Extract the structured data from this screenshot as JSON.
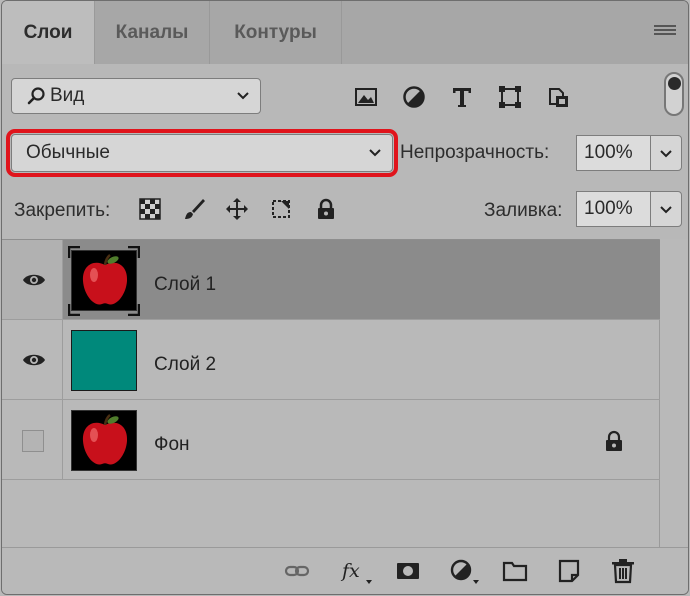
{
  "tabs": [
    {
      "label": "Слои",
      "active": true
    },
    {
      "label": "Каналы",
      "active": false
    },
    {
      "label": "Контуры",
      "active": false
    }
  ],
  "filter": {
    "label": "Вид"
  },
  "blend_mode": {
    "value": "Обычные",
    "highlight_color": "#e0141c"
  },
  "opacity": {
    "label": "Непрозрачность:",
    "value": "100%"
  },
  "lock": {
    "label": "Закрепить:"
  },
  "fill": {
    "label": "Заливка:",
    "value": "100%"
  },
  "layers": [
    {
      "name": "Слой 1",
      "visible": true,
      "selected": true,
      "thumb": "apple"
    },
    {
      "name": "Слой 2",
      "visible": true,
      "selected": false,
      "thumb": "teal",
      "thumb_color": "#00897b"
    },
    {
      "name": "Фон",
      "visible": false,
      "selected": false,
      "thumb": "apple",
      "locked": true
    }
  ],
  "bottom_icons": [
    "link-icon",
    "fx-icon",
    "mask-icon",
    "adjustment-icon",
    "folder-icon",
    "new-layer-icon",
    "trash-icon"
  ]
}
